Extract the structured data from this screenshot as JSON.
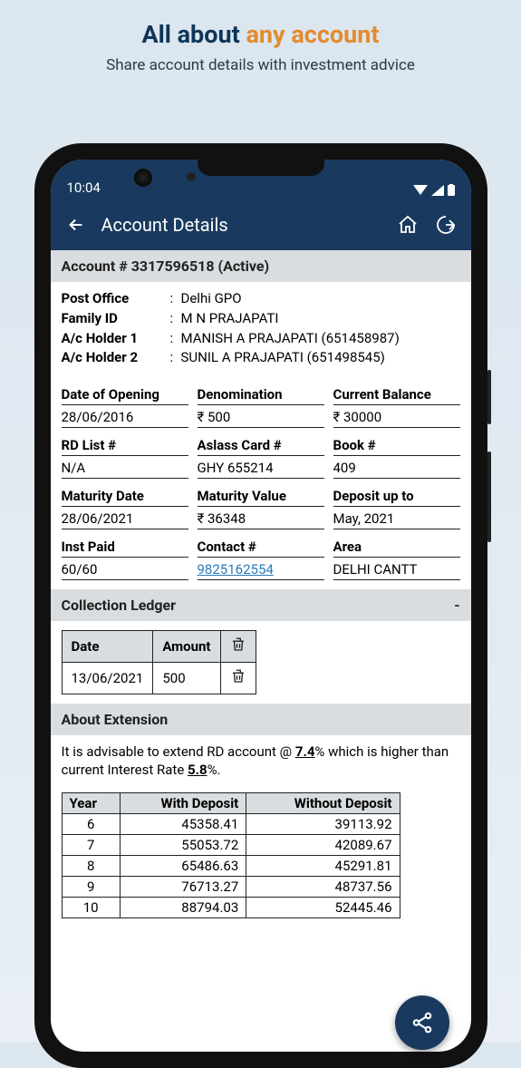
{
  "promo": {
    "title_part1": "All about ",
    "title_part2": "any account",
    "subtitle": "Share account details with investment advice"
  },
  "statusbar": {
    "time": "10:04"
  },
  "appbar": {
    "title": "Account Details"
  },
  "account": {
    "heading": "Account # 3317596518 (Active)",
    "post_office_label": "Post Office",
    "post_office": "Delhi GPO",
    "family_id_label": "Family ID",
    "family_id": "M N PRAJAPATI",
    "holder1_label": "A/c Holder 1",
    "holder1": "MANISH A PRAJAPATI (651458987)",
    "holder2_label": "A/c Holder 2",
    "holder2": "SUNIL A PRAJAPATI (651498545)"
  },
  "fields": [
    {
      "label": "Date of Opening",
      "value": "28/06/2016"
    },
    {
      "label": "Denomination",
      "value": "₹ 500"
    },
    {
      "label": "Current Balance",
      "value": "₹ 30000"
    },
    {
      "label": "RD List #",
      "value": "N/A"
    },
    {
      "label": "Aslass Card #",
      "value": "GHY 655214"
    },
    {
      "label": "Book #",
      "value": "409"
    },
    {
      "label": "Maturity Date",
      "value": "28/06/2021"
    },
    {
      "label": "Maturity Value",
      "value": "₹ 36348"
    },
    {
      "label": "Deposit up to",
      "value": "May, 2021"
    },
    {
      "label": "Inst Paid",
      "value": "60/60"
    },
    {
      "label": "Contact #",
      "value": "9825162554",
      "link": true
    },
    {
      "label": "Area",
      "value": "DELHI CANTT"
    }
  ],
  "ledger": {
    "heading": "Collection Ledger",
    "collapse": "-",
    "cols": [
      "Date",
      "Amount"
    ],
    "rows": [
      {
        "date": "13/06/2021",
        "amount": "500"
      }
    ]
  },
  "extension": {
    "heading": "About Extension",
    "advice_pre": "It is advisable to extend RD account @ ",
    "advice_rate1": "7.4",
    "advice_mid": "% which is higher than current Interest Rate ",
    "advice_rate2": "5.8",
    "advice_post": "%.",
    "cols": [
      "Year",
      "With Deposit",
      "Without Deposit"
    ],
    "rows": [
      {
        "year": "6",
        "with": "45358.41",
        "without": "39113.92"
      },
      {
        "year": "7",
        "with": "55053.72",
        "without": "42089.67"
      },
      {
        "year": "8",
        "with": "65486.63",
        "without": "45291.81"
      },
      {
        "year": "9",
        "with": "76713.27",
        "without": "48737.56"
      },
      {
        "year": "10",
        "with": "88794.03",
        "without": "52445.46"
      }
    ]
  }
}
